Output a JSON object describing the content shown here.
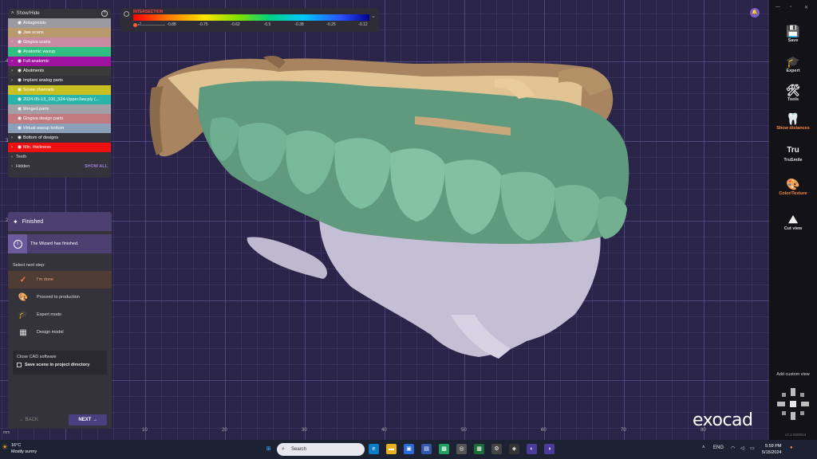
{
  "show_hide": {
    "title": "Show/Hide",
    "help_icon": "?",
    "layers": [
      {
        "label": "Antagonists",
        "color": "#9a9aa0",
        "chevron": false
      },
      {
        "label": "Jaw scans",
        "color": "#b89a6e",
        "chevron": false
      },
      {
        "label": "Gingiva scans",
        "color": "#c78aa0",
        "chevron": true
      },
      {
        "label": "Anatomic waxup",
        "color": "#2fbf80",
        "chevron": false
      },
      {
        "label": "Full anatomic",
        "color": "#a012a0",
        "chevron": true
      },
      {
        "label": "Abutments",
        "color": "#3a3a3a",
        "chevron": true
      },
      {
        "label": "Implant analog parts",
        "color": "#34323a",
        "chevron": true
      },
      {
        "label": "Screw channels",
        "color": "#c8c020",
        "chevron": true
      },
      {
        "label": "2024-05-13_100_524-UpperJaw.ply (...",
        "color": "#28b4a8",
        "chevron": false
      },
      {
        "label": "Merged parts",
        "color": "#a0a0a6",
        "chevron": false
      },
      {
        "label": "Gingiva design parts",
        "color": "#c07a80",
        "chevron": false
      },
      {
        "label": "Virtual waxup bottom",
        "color": "#8aa0b8",
        "chevron": false
      },
      {
        "label": "Bottom of designs",
        "color": "#34323a",
        "chevron": true
      },
      {
        "label": "Min. thickness",
        "color": "#ee1010",
        "chevron": true
      }
    ],
    "teeth_label": "Teeth",
    "hidden_label": "Hidden",
    "show_all": "SHOW ALL"
  },
  "wizard": {
    "title": "Finished",
    "info": "The Wizard has finished.",
    "select_next": "Select next step:",
    "steps": [
      {
        "label": "I'm done",
        "icon": "checkmark-icon"
      },
      {
        "label": "Proceed to production",
        "icon": "palette-icon"
      },
      {
        "label": "Expert mode",
        "icon": "graduation-cap-icon"
      },
      {
        "label": "Design model",
        "icon": "model-icon"
      }
    ],
    "close_cad": "Close CAD software",
    "save_scene": "Save scene in project directory",
    "back": "BACK",
    "next": "NEXT"
  },
  "intersection": {
    "label": "INTERSECTION",
    "ticks": [
      "-1",
      "-0.88",
      "-0.75",
      "-0.62",
      "-0.5",
      "-0.38",
      "-0.25",
      "-0.12"
    ]
  },
  "toolbar": {
    "window_controls": [
      "—",
      "▫",
      "✕"
    ],
    "tools": [
      {
        "label": "Save",
        "icon": "save-icon",
        "glyph": "💾",
        "hot": false
      },
      {
        "label": "Expert",
        "icon": "expert-icon",
        "glyph": "🎓",
        "hot": false
      },
      {
        "label": "Tools",
        "icon": "tools-icon",
        "glyph": "🛠",
        "hot": false
      },
      {
        "label": "Show distances",
        "icon": "distances-icon",
        "glyph": "🦷",
        "hot": true
      },
      {
        "label": "TruSmile",
        "icon": "trusmile-icon",
        "glyph": "Tru",
        "hot": false
      },
      {
        "label": "Color/Texture",
        "icon": "color-texture-icon",
        "glyph": "🎨",
        "hot": true
      },
      {
        "label": "Cut view",
        "icon": "cut-view-icon",
        "glyph": "⛰",
        "hot": false
      }
    ],
    "add_custom_view": "Add custom view",
    "version": "v3.1-8200/64"
  },
  "viewport": {
    "logo": "exocad",
    "unit": "mm",
    "x_ticks": [
      "10",
      "20",
      "30",
      "40",
      "50",
      "60",
      "70",
      "80"
    ],
    "y_ticks": [
      "4",
      "3",
      "2"
    ]
  },
  "taskbar": {
    "temp": "16°C",
    "weather": "Mostly sunny",
    "search_placeholder": "Search",
    "lang": "ENG",
    "time": "5:59 PM",
    "date": "5/15/2024"
  }
}
